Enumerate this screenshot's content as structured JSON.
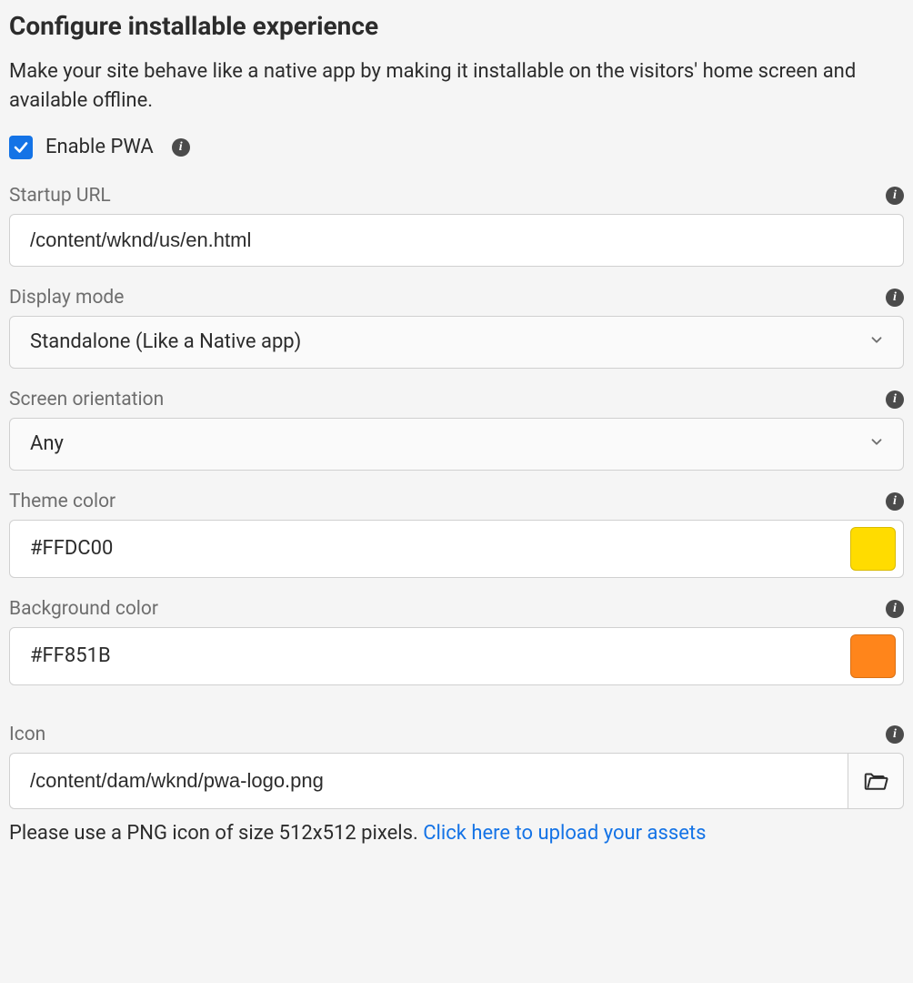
{
  "header": {
    "title": "Configure installable experience",
    "description": "Make your site behave like a native app by making it installable on the visitors' home screen and available offline."
  },
  "enable": {
    "label": "Enable PWA",
    "checked": true
  },
  "fields": {
    "startup_url": {
      "label": "Startup URL",
      "value": "/content/wknd/us/en.html"
    },
    "display_mode": {
      "label": "Display mode",
      "value": "Standalone (Like a Native app)"
    },
    "screen_orientation": {
      "label": "Screen orientation",
      "value": "Any"
    },
    "theme_color": {
      "label": "Theme color",
      "value": "#FFDC00",
      "swatch": "#FFDC00"
    },
    "background_color": {
      "label": "Background color",
      "value": "#FF851B",
      "swatch": "#FF851B"
    },
    "icon": {
      "label": "Icon",
      "value": "/content/dam/wknd/pwa-logo.png",
      "helper_prefix": "Please use a PNG icon of size 512x512 pixels. ",
      "helper_link": "Click here to upload your assets"
    }
  }
}
